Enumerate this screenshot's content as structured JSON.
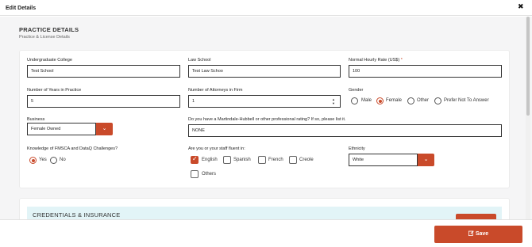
{
  "modal": {
    "title": "Edit Details",
    "close_glyph": "✖"
  },
  "practice": {
    "title": "PRACTICE DETAILS",
    "subtitle": "Practice & License Details"
  },
  "fields": {
    "undergrad": {
      "label": "Undergraduate College",
      "value": "Test School"
    },
    "law_school": {
      "label": "Law School",
      "value": "Test Law Schoo"
    },
    "hourly_rate": {
      "label": "Normal Hourly Rate (US$)",
      "required": "*",
      "value": "100"
    },
    "years": {
      "label": "Number of Years in Practice",
      "value": "5"
    },
    "attorneys": {
      "label": "Number of Attorneys in Firm",
      "value": "1"
    },
    "gender": {
      "label": "Gender",
      "options": [
        "Male",
        "Female",
        "Other",
        "Prefer Not To Answer"
      ],
      "selected": "Female"
    },
    "business": {
      "label": "Business",
      "value": "Female Owned"
    },
    "rating": {
      "label": "Do you have a Martindale-Hubbell or other professional rating? If so, please list it.",
      "value": "NONE"
    },
    "fmsca": {
      "label": "Knowledge of FMSCA and DataQ Challenges?",
      "options": [
        "Yes",
        "No"
      ],
      "selected": "Yes"
    },
    "languages": {
      "label": "Are you or your staff fluent in:",
      "options": [
        "English",
        "Spanish",
        "French",
        "Creole",
        "Others"
      ],
      "checked": [
        "English"
      ]
    },
    "ethnicity": {
      "label": "Ethnicity",
      "value": "White"
    }
  },
  "credentials": {
    "title": "CREDENTIALS & INSURANCE"
  },
  "footer": {
    "save_label": "Save"
  },
  "colors": {
    "accent": "#c94a2a",
    "cred_header_bg": "#e2f4f7",
    "page_bg": "#f5f5f6"
  }
}
